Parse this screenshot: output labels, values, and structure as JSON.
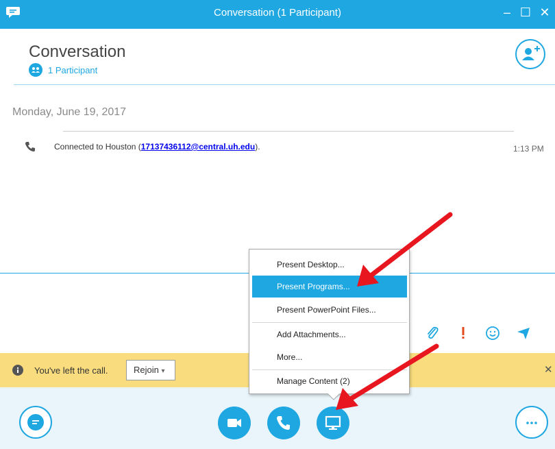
{
  "window": {
    "title": "Conversation (1 Participant)",
    "minimize_symbol": "–",
    "maximize_symbol": "☐",
    "close_symbol": "✕"
  },
  "header": {
    "title": "Conversation",
    "participants": "1 Participant"
  },
  "history": {
    "date": "Monday, June 19, 2017",
    "message_prefix": "Connected to Houston (",
    "message_link": "17137436112@central.uh.edu",
    "message_suffix": ").",
    "time": "1:13 PM"
  },
  "present_menu": {
    "items": [
      {
        "label": "Present Desktop..."
      },
      {
        "label": "Present Programs..."
      },
      {
        "label": "Present PowerPoint Files..."
      },
      {
        "label": "Add Attachments..."
      },
      {
        "label": "More..."
      },
      {
        "label": "Manage Content (2)"
      }
    ]
  },
  "notification": {
    "text": "You've left the call.",
    "rejoin_label": "Rejoin",
    "rejoin_arrow": "▾",
    "close_symbol": "✕"
  },
  "colors": {
    "accent": "#1ea7e1",
    "notification_bg": "#f8dc7e",
    "annotation_arrow": "#e8161f",
    "important": "#e24a1c"
  }
}
